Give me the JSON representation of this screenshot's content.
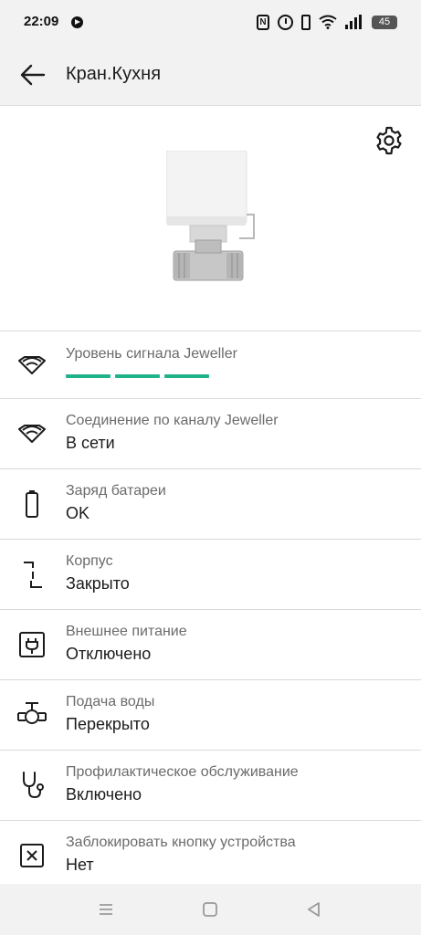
{
  "status_bar": {
    "time": "22:09",
    "battery_level": "45",
    "nfc_label": "N"
  },
  "app_bar": {
    "title": "Кран.Кухня"
  },
  "rows": [
    {
      "label": "Уровень сигнала Jeweller",
      "signal_bars_filled": 3,
      "signal_bars_total": 3,
      "icon": "signal-strength-icon"
    },
    {
      "label": "Соединение по каналу Jeweller",
      "value": "В сети",
      "icon": "connection-icon"
    },
    {
      "label": "Заряд батареи",
      "value": "OK",
      "icon": "battery-icon"
    },
    {
      "label": "Корпус",
      "value": "Закрыто",
      "icon": "tamper-icon"
    },
    {
      "label": "Внешнее питание",
      "value": "Отключено",
      "icon": "external-power-icon"
    },
    {
      "label": "Подача воды",
      "value": "Перекрыто",
      "icon": "water-valve-icon"
    },
    {
      "label": "Профилактическое обслуживание",
      "value": "Включено",
      "icon": "stethoscope-icon"
    },
    {
      "label": "Заблокировать кнопку устройства",
      "value": "Нет",
      "icon": "lock-button-icon"
    }
  ],
  "colors": {
    "accent_signal": "#1fb38a",
    "bar_background": "#f2f2f2"
  }
}
